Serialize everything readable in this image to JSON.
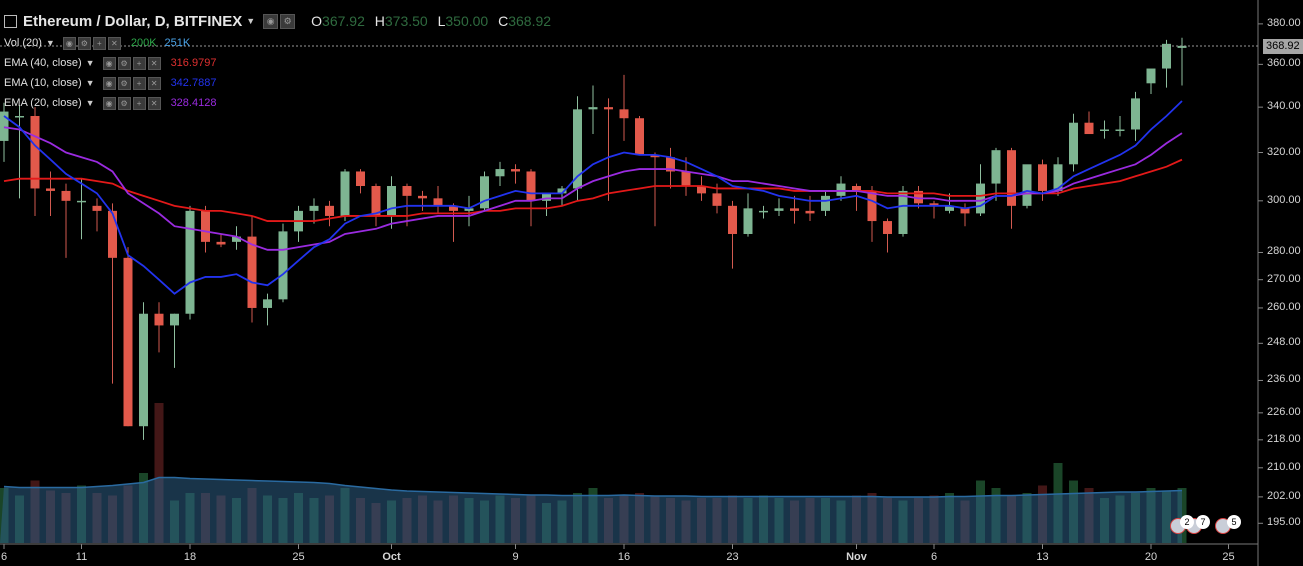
{
  "header": {
    "title": "Ethereum / Dollar, D, BITFINEX",
    "o_label": "O",
    "o_value": "367.92",
    "h_label": "H",
    "h_value": "373.50",
    "l_label": "L",
    "l_value": "350.00",
    "c_label": "C",
    "c_value": "368.92"
  },
  "indicators": [
    {
      "label": "Vol (20)",
      "values": [
        "200K",
        "251K"
      ],
      "colors": [
        "#2ea84a",
        "#4aa3e8"
      ]
    },
    {
      "label": "EMA (40, close)",
      "values": [
        "316.9797"
      ],
      "colors": [
        "#e03030"
      ]
    },
    {
      "label": "EMA (10, close)",
      "values": [
        "342.7887"
      ],
      "colors": [
        "#2233ee"
      ]
    },
    {
      "label": "EMA (20, close)",
      "values": [
        "328.4128"
      ],
      "colors": [
        "#9a2be0"
      ]
    }
  ],
  "last_price": "368.92",
  "y_ticks": [
    "380.00",
    "360.00",
    "340.00",
    "320.00",
    "300.00",
    "280.00",
    "270.00",
    "260.00",
    "248.00",
    "236.00",
    "226.00",
    "218.00",
    "210.00",
    "202.00",
    "195.00"
  ],
  "x_ticks": [
    "6",
    "11",
    "18",
    "25",
    "Oct",
    "9",
    "16",
    "23",
    "Nov",
    "6",
    "13",
    "20",
    "25"
  ],
  "event_badges": [
    "2",
    "7",
    "5"
  ],
  "colors": {
    "up": "#7eb592",
    "down": "#e2594b",
    "ema10": "#2233ee",
    "ema20": "#9a2be0",
    "ema40": "#e31919",
    "volume_ma": "#2d5e85"
  },
  "chart_data": {
    "type": "candlestick",
    "title": "Ethereum / Dollar, D, BITFINEX",
    "y_scale": "log",
    "ylim": [
      193,
      383
    ],
    "dates": [
      "Sep 6",
      "Sep 7",
      "Sep 8",
      "Sep 9",
      "Sep 10",
      "Sep 11",
      "Sep 12",
      "Sep 13",
      "Sep 14",
      "Sep 15",
      "Sep 16",
      "Sep 17",
      "Sep 18",
      "Sep 19",
      "Sep 20",
      "Sep 21",
      "Sep 22",
      "Sep 23",
      "Sep 24",
      "Sep 25",
      "Sep 26",
      "Sep 27",
      "Sep 28",
      "Sep 29",
      "Sep 30",
      "Oct 1",
      "Oct 2",
      "Oct 3",
      "Oct 4",
      "Oct 5",
      "Oct 6",
      "Oct 7",
      "Oct 8",
      "Oct 9",
      "Oct 10",
      "Oct 11",
      "Oct 12",
      "Oct 13",
      "Oct 14",
      "Oct 15",
      "Oct 16",
      "Oct 17",
      "Oct 18",
      "Oct 19",
      "Oct 20",
      "Oct 21",
      "Oct 22",
      "Oct 23",
      "Oct 24",
      "Oct 25",
      "Oct 26",
      "Oct 27",
      "Oct 28",
      "Oct 29",
      "Oct 30",
      "Oct 31",
      "Nov 1",
      "Nov 2",
      "Nov 3",
      "Nov 4",
      "Nov 5",
      "Nov 6",
      "Nov 7",
      "Nov 8",
      "Nov 9",
      "Nov 10",
      "Nov 11",
      "Nov 12",
      "Nov 13",
      "Nov 14",
      "Nov 15",
      "Nov 16",
      "Nov 17",
      "Nov 18",
      "Nov 19",
      "Nov 20",
      "Nov 21"
    ],
    "ohlc": [
      [
        325,
        342,
        316,
        338
      ],
      [
        336,
        341,
        301,
        336
      ],
      [
        336,
        340,
        294,
        305
      ],
      [
        305,
        312,
        294,
        304
      ],
      [
        304,
        307,
        278,
        300
      ],
      [
        300,
        309,
        285,
        300
      ],
      [
        298,
        301,
        288,
        296
      ],
      [
        296,
        299,
        235,
        278
      ],
      [
        278,
        282,
        222,
        222
      ],
      [
        222,
        262,
        218,
        258
      ],
      [
        258,
        262,
        245,
        254
      ],
      [
        254,
        258,
        240,
        258
      ],
      [
        258,
        298,
        256,
        296
      ],
      [
        296,
        298,
        280,
        284
      ],
      [
        284,
        287,
        282,
        283
      ],
      [
        284,
        290,
        281,
        286
      ],
      [
        286,
        294,
        255,
        260
      ],
      [
        260,
        265,
        254,
        263
      ],
      [
        263,
        291,
        262,
        288
      ],
      [
        288,
        298,
        284,
        296
      ],
      [
        296,
        301,
        291,
        298
      ],
      [
        298,
        300,
        290,
        294
      ],
      [
        294,
        313,
        292,
        312
      ],
      [
        312,
        313,
        303,
        306
      ],
      [
        306,
        307,
        290,
        294
      ],
      [
        294,
        310,
        289,
        306
      ],
      [
        306,
        307,
        290,
        302
      ],
      [
        302,
        304,
        296,
        301
      ],
      [
        301,
        306,
        295,
        298
      ],
      [
        298,
        299,
        284,
        296
      ],
      [
        296,
        302,
        290,
        297
      ],
      [
        297,
        312,
        296,
        310
      ],
      [
        310,
        316,
        306,
        313
      ],
      [
        313,
        315,
        307,
        312
      ],
      [
        312,
        313,
        290,
        300
      ],
      [
        300,
        303,
        294,
        303
      ],
      [
        303,
        306,
        298,
        305
      ],
      [
        305,
        345,
        300,
        339
      ],
      [
        339,
        350,
        328,
        340
      ],
      [
        340,
        344,
        300,
        339
      ],
      [
        339,
        355,
        325,
        335
      ],
      [
        335,
        336,
        322,
        319
      ],
      [
        319,
        320,
        290,
        318
      ],
      [
        318,
        322,
        305,
        312
      ],
      [
        312,
        318,
        302,
        306
      ],
      [
        306,
        310,
        300,
        303
      ],
      [
        303,
        307,
        295,
        298
      ],
      [
        298,
        300,
        274,
        287
      ],
      [
        287,
        303,
        286,
        297
      ],
      [
        296,
        298,
        293,
        296
      ],
      [
        296,
        301,
        294,
        297
      ],
      [
        297,
        302,
        291,
        296
      ],
      [
        296,
        302,
        292,
        295
      ],
      [
        296,
        304,
        294,
        302
      ],
      [
        302,
        310,
        300,
        307
      ],
      [
        306,
        307,
        296,
        304
      ],
      [
        304,
        306,
        284,
        292
      ],
      [
        292,
        293,
        280,
        287
      ],
      [
        287,
        306,
        286,
        304
      ],
      [
        304,
        306,
        297,
        299
      ],
      [
        299,
        300,
        293,
        298
      ],
      [
        296,
        303,
        295,
        298
      ],
      [
        297,
        299,
        290,
        295
      ],
      [
        295,
        315,
        294,
        307
      ],
      [
        307,
        322,
        300,
        321
      ],
      [
        321,
        322,
        289,
        298
      ],
      [
        298,
        312,
        297,
        315
      ],
      [
        315,
        317,
        300,
        304
      ],
      [
        304,
        318,
        302,
        315
      ],
      [
        315,
        337,
        312,
        333
      ],
      [
        333,
        338,
        328,
        328
      ],
      [
        330,
        334,
        326,
        330
      ],
      [
        330,
        336,
        327,
        330
      ],
      [
        330,
        347,
        325,
        344
      ],
      [
        351,
        357,
        346,
        358
      ],
      [
        358,
        372,
        349,
        370
      ],
      [
        368,
        373,
        350,
        369
      ]
    ],
    "volume": [
      110,
      95,
      125,
      105,
      100,
      115,
      100,
      95,
      115,
      140,
      280,
      85,
      100,
      100,
      95,
      90,
      110,
      95,
      90,
      100,
      90,
      95,
      110,
      90,
      80,
      85,
      90,
      95,
      85,
      95,
      90,
      85,
      95,
      90,
      95,
      80,
      85,
      100,
      110,
      90,
      95,
      100,
      95,
      90,
      85,
      90,
      90,
      95,
      90,
      95,
      90,
      85,
      90,
      90,
      85,
      95,
      100,
      90,
      85,
      90,
      95,
      100,
      85,
      125,
      110,
      95,
      100,
      115,
      160,
      125,
      110,
      90,
      95,
      100,
      110,
      105,
      110
    ],
    "volume_ma": [
      113,
      111,
      111,
      111,
      111,
      111,
      113,
      115,
      118,
      121,
      131,
      131,
      129,
      128,
      127,
      126,
      125,
      124,
      123,
      122,
      121,
      119,
      115,
      112,
      109,
      106,
      104,
      103,
      102,
      101,
      100,
      99,
      98,
      97,
      96,
      96,
      95,
      95,
      95,
      95,
      96,
      95,
      94,
      94,
      94,
      93,
      93,
      93,
      93,
      93,
      93,
      93,
      93,
      93,
      93,
      93,
      93,
      92,
      92,
      92,
      92,
      93,
      93,
      94,
      95,
      95,
      96,
      97,
      98,
      99,
      100,
      101,
      102,
      102,
      103,
      104,
      105
    ],
    "ema10": [
      336,
      331,
      323,
      317,
      311,
      307,
      303,
      295,
      279,
      275,
      270,
      265,
      269,
      271,
      271,
      272,
      269,
      268,
      272,
      277,
      282,
      285,
      291,
      294,
      295,
      297,
      298,
      298,
      298,
      298,
      297,
      300,
      302,
      304,
      303,
      303,
      303,
      310,
      315,
      318,
      320,
      319,
      319,
      318,
      316,
      313,
      310,
      306,
      305,
      304,
      302,
      301,
      300,
      300,
      301,
      302,
      300,
      297,
      298,
      298,
      298,
      298,
      297,
      298,
      302,
      302,
      304,
      303,
      305,
      310,
      313,
      316,
      319,
      323,
      330,
      336,
      342.79
    ],
    "ema20": [
      331,
      330,
      327,
      324,
      320,
      318,
      316,
      312,
      303,
      299,
      295,
      290,
      289,
      288,
      287,
      286,
      283,
      281,
      281,
      282,
      283,
      284,
      287,
      288,
      289,
      291,
      292,
      293,
      294,
      294,
      294,
      296,
      298,
      300,
      300,
      301,
      301,
      305,
      308,
      310,
      312,
      313,
      313,
      313,
      312,
      311,
      310,
      308,
      308,
      307,
      306,
      305,
      304,
      304,
      304,
      304,
      303,
      302,
      302,
      301,
      301,
      300,
      300,
      300,
      302,
      302,
      303,
      303,
      304,
      307,
      309,
      311,
      313,
      315,
      319,
      324,
      328.41
    ],
    "ema40": [
      308,
      309,
      309,
      309,
      309,
      309,
      308,
      307,
      304,
      302,
      300,
      298,
      297,
      296,
      296,
      295,
      294,
      292,
      292,
      292,
      292,
      293,
      294,
      294,
      294,
      294,
      294,
      295,
      295,
      295,
      295,
      296,
      296,
      297,
      297,
      297,
      298,
      300,
      301,
      303,
      304,
      305,
      306,
      306,
      306,
      306,
      305,
      305,
      305,
      305,
      305,
      304,
      304,
      304,
      304,
      304,
      304,
      303,
      303,
      303,
      303,
      302,
      302,
      302,
      303,
      303,
      303,
      303,
      303,
      305,
      306,
      307,
      308,
      310,
      312,
      314,
      316.98
    ],
    "x_tick_positions": [
      0,
      5,
      12,
      19,
      25,
      33,
      40,
      47,
      55,
      60,
      67,
      74,
      79
    ]
  }
}
